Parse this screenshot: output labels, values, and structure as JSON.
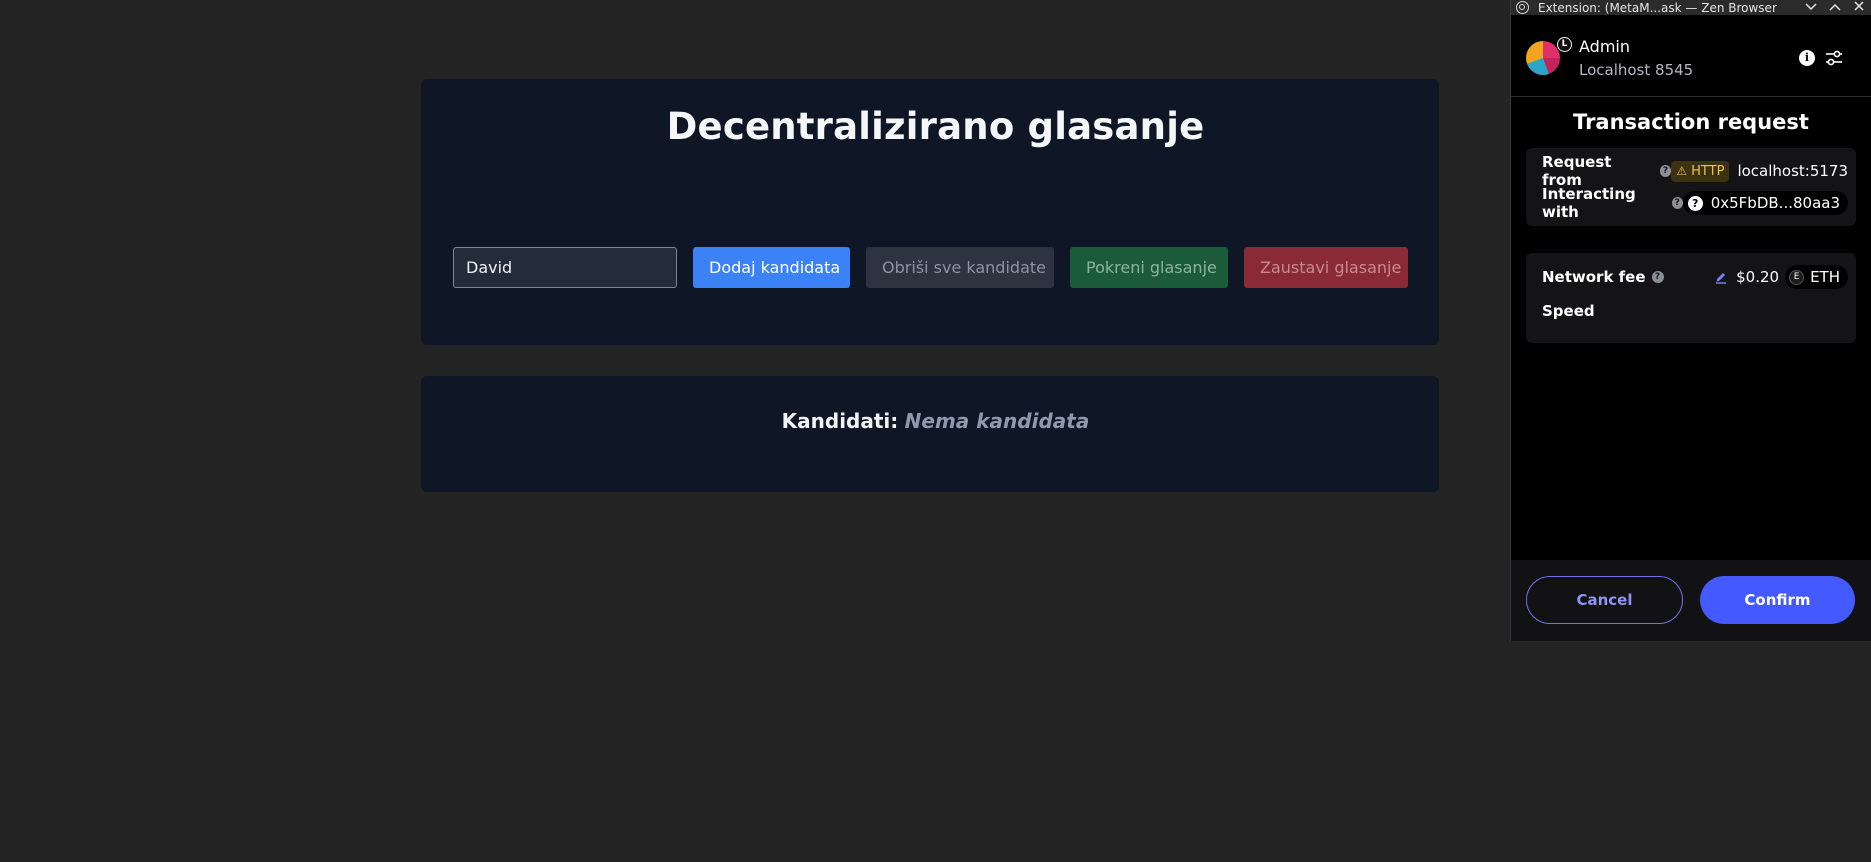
{
  "app": {
    "title": "Decentralizirano glasanje",
    "input_value": "David",
    "buttons": {
      "add": "Dodaj kandidata",
      "clear": "Obriši sve kandidate",
      "start": "Pokreni glasanje",
      "stop": "Zaustavi glasanje"
    },
    "candidates_label": "Kandidati:",
    "candidates_empty": "Nema kandidata"
  },
  "extension": {
    "window_title": "Extension: (MetaM...ask — Zen Browser",
    "account": {
      "name": "Admin",
      "network": "Localhost 8545",
      "avatar_badge": "L"
    },
    "title": "Transaction request",
    "request_from": {
      "label": "Request from",
      "badge": "HTTP",
      "host": "localhost:5173"
    },
    "interacting_with": {
      "label": "Interacting with",
      "address": "0x5FbDB...80aa3"
    },
    "fee": {
      "label": "Network fee",
      "amount": "$0.20",
      "currency": "ETH",
      "coin_letter": "E"
    },
    "speed_label": "Speed",
    "cancel_label": "Cancel",
    "confirm_label": "Confirm"
  },
  "colors": {
    "page_bg": "#242424",
    "card_bg": "#0f1626",
    "add_button": "#3b82f6",
    "start_button": "#1c5b39",
    "stop_button": "#8a2a37",
    "confirm_button": "#4459ff",
    "http_warning": "#f0c04c"
  },
  "icons": {
    "browser": "browser-logo-icon",
    "minimize": "chevron-down-icon",
    "maximize": "chevron-up-icon",
    "close": "close-icon",
    "info": "info-icon",
    "settings": "sliders-icon",
    "help": "question-icon",
    "warning": "warning-icon",
    "edit": "edit-icon",
    "eth": "eth-icon"
  }
}
